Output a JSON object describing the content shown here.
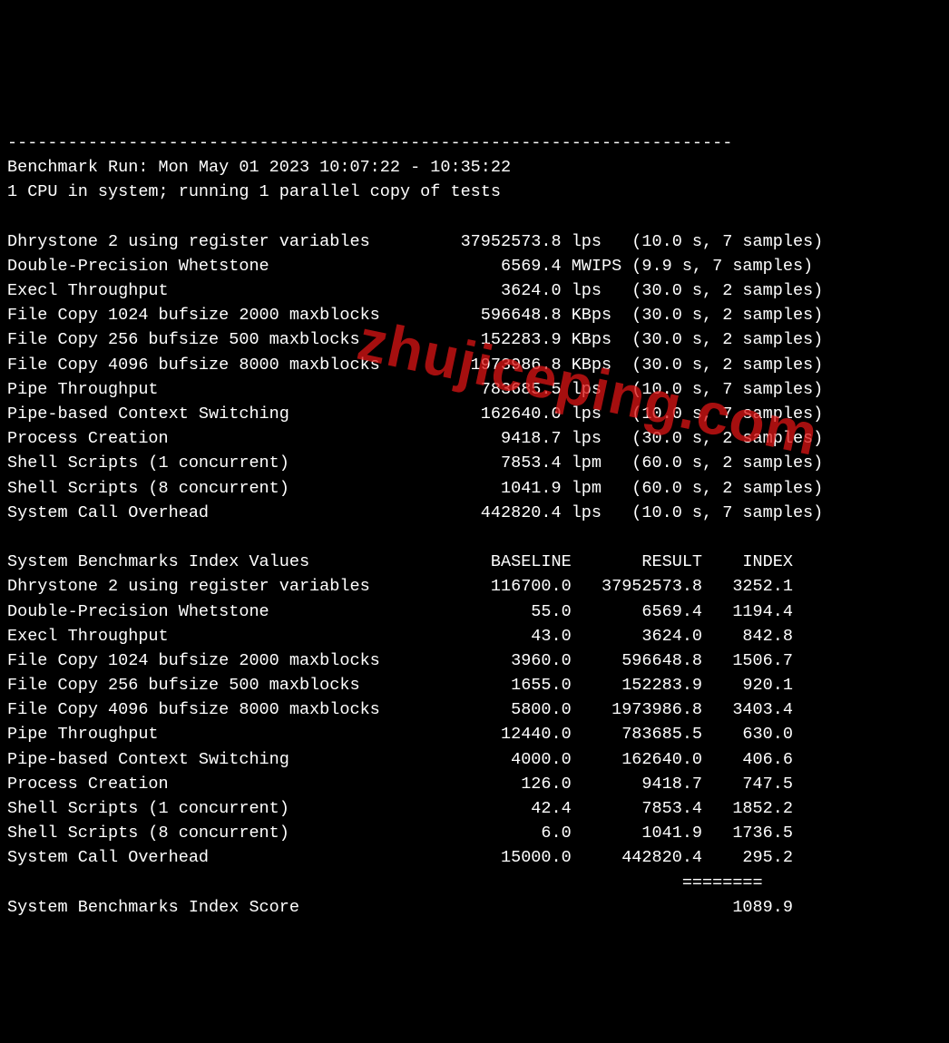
{
  "divider": "------------------------------------------------------------------------",
  "run_header": "Benchmark Run: Mon May 01 2023 10:07:22 - 10:35:22",
  "cpu_line": "1 CPU in system; running 1 parallel copy of tests",
  "watermark": "zhujiceping.com",
  "tests": [
    {
      "name": "Dhrystone 2 using register variables",
      "value": "37952573.8",
      "unit": "lps",
      "timing": "(10.0 s, 7 samples)"
    },
    {
      "name": "Double-Precision Whetstone",
      "value": "6569.4",
      "unit": "MWIPS",
      "timing": "(9.9 s, 7 samples)"
    },
    {
      "name": "Execl Throughput",
      "value": "3624.0",
      "unit": "lps",
      "timing": "(30.0 s, 2 samples)"
    },
    {
      "name": "File Copy 1024 bufsize 2000 maxblocks",
      "value": "596648.8",
      "unit": "KBps",
      "timing": "(30.0 s, 2 samples)"
    },
    {
      "name": "File Copy 256 bufsize 500 maxblocks",
      "value": "152283.9",
      "unit": "KBps",
      "timing": "(30.0 s, 2 samples)"
    },
    {
      "name": "File Copy 4096 bufsize 8000 maxblocks",
      "value": "1973986.8",
      "unit": "KBps",
      "timing": "(30.0 s, 2 samples)"
    },
    {
      "name": "Pipe Throughput",
      "value": "783685.5",
      "unit": "lps",
      "timing": "(10.0 s, 7 samples)"
    },
    {
      "name": "Pipe-based Context Switching",
      "value": "162640.0",
      "unit": "lps",
      "timing": "(10.0 s, 7 samples)"
    },
    {
      "name": "Process Creation",
      "value": "9418.7",
      "unit": "lps",
      "timing": "(30.0 s, 2 samples)"
    },
    {
      "name": "Shell Scripts (1 concurrent)",
      "value": "7853.4",
      "unit": "lpm",
      "timing": "(60.0 s, 2 samples)"
    },
    {
      "name": "Shell Scripts (8 concurrent)",
      "value": "1041.9",
      "unit": "lpm",
      "timing": "(60.0 s, 2 samples)"
    },
    {
      "name": "System Call Overhead",
      "value": "442820.4",
      "unit": "lps",
      "timing": "(10.0 s, 7 samples)"
    }
  ],
  "index_header": {
    "label": "System Benchmarks Index Values",
    "baseline": "BASELINE",
    "result": "RESULT",
    "index": "INDEX"
  },
  "indexes": [
    {
      "name": "Dhrystone 2 using register variables",
      "baseline": "116700.0",
      "result": "37952573.8",
      "index": "3252.1"
    },
    {
      "name": "Double-Precision Whetstone",
      "baseline": "55.0",
      "result": "6569.4",
      "index": "1194.4"
    },
    {
      "name": "Execl Throughput",
      "baseline": "43.0",
      "result": "3624.0",
      "index": "842.8"
    },
    {
      "name": "File Copy 1024 bufsize 2000 maxblocks",
      "baseline": "3960.0",
      "result": "596648.8",
      "index": "1506.7"
    },
    {
      "name": "File Copy 256 bufsize 500 maxblocks",
      "baseline": "1655.0",
      "result": "152283.9",
      "index": "920.1"
    },
    {
      "name": "File Copy 4096 bufsize 8000 maxblocks",
      "baseline": "5800.0",
      "result": "1973986.8",
      "index": "3403.4"
    },
    {
      "name": "Pipe Throughput",
      "baseline": "12440.0",
      "result": "783685.5",
      "index": "630.0"
    },
    {
      "name": "Pipe-based Context Switching",
      "baseline": "4000.0",
      "result": "162640.0",
      "index": "406.6"
    },
    {
      "name": "Process Creation",
      "baseline": "126.0",
      "result": "9418.7",
      "index": "747.5"
    },
    {
      "name": "Shell Scripts (1 concurrent)",
      "baseline": "42.4",
      "result": "7853.4",
      "index": "1852.2"
    },
    {
      "name": "Shell Scripts (8 concurrent)",
      "baseline": "6.0",
      "result": "1041.9",
      "index": "1736.5"
    },
    {
      "name": "System Call Overhead",
      "baseline": "15000.0",
      "result": "442820.4",
      "index": "295.2"
    }
  ],
  "score_divider": "                                                                   ========",
  "score_line": {
    "label": "System Benchmarks Index Score",
    "value": "1089.9"
  }
}
